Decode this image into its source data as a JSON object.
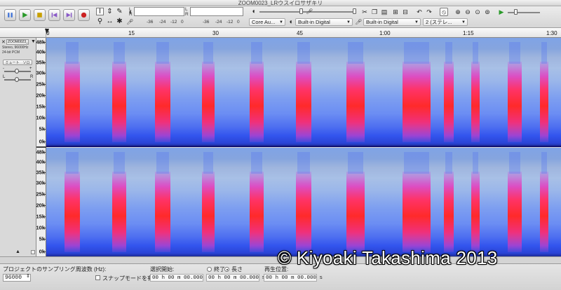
{
  "window": {
    "title": "ZOOM0023_LRウスイロサザキリ"
  },
  "toolbar": {
    "transport": [
      {
        "name": "pause",
        "color": "#3a6fd8"
      },
      {
        "name": "play",
        "color": "#2a9a2a"
      },
      {
        "name": "stop",
        "color": "#c8a000"
      },
      {
        "name": "skip-start",
        "color": "#8a5ac8"
      },
      {
        "name": "skip-end",
        "color": "#8a5ac8"
      },
      {
        "name": "record",
        "color": "#cc2222"
      }
    ],
    "meter_left_channel": "L",
    "meter_right_channel": "R",
    "meter_scale": [
      "-36",
      "-24",
      "-12",
      "0"
    ],
    "meter_scale_2": [
      "-36",
      "-24",
      "-12",
      "0"
    ],
    "audio_host": "Core Au...",
    "output_device": "Built-in Digital",
    "input_device": "Built-in Digital",
    "input_channels": "2 (ステレ..."
  },
  "ruler": {
    "ticks": [
      "0",
      "15",
      "30",
      "45",
      "1:00",
      "1:15",
      "1:30"
    ]
  },
  "track": {
    "name": "ZOOM0023_LR?",
    "info_line1": "Stereo, 96000Hz",
    "info_line2": "24-bit PCM",
    "mute": "ミュート",
    "solo": "ソロ",
    "gain_minus": "-",
    "gain_plus": "+",
    "pan_left": "L",
    "pan_right": "R"
  },
  "scale_labels": [
    "48k",
    "40k",
    "35k",
    "30k",
    "25k",
    "20k",
    "15k",
    "10k",
    "5k",
    "0k"
  ],
  "status": {
    "rate_label": "プロジェクトのサンプリング周波数 (Hz):",
    "rate_value": "96000",
    "snap_label": "スナップモードを有効",
    "sel_start_label": "選択開始:",
    "end_label": "終了",
    "length_label": "長さ",
    "pos_label": "再生位置:",
    "sel_start_value": "00 h 00 m 00.000 s",
    "sel_end_value": "00 h 00 m 00.000 s",
    "pos_value": "00 h 00 m 00.000 s"
  },
  "watermark": "© Kiyoaki Takashima 2013",
  "colors": {
    "spectro_low": "#1a2a9a",
    "spectro_mid": "#8aa6e6",
    "burst_pink": "#e83ab0",
    "burst_red": "#ff2a2a"
  }
}
